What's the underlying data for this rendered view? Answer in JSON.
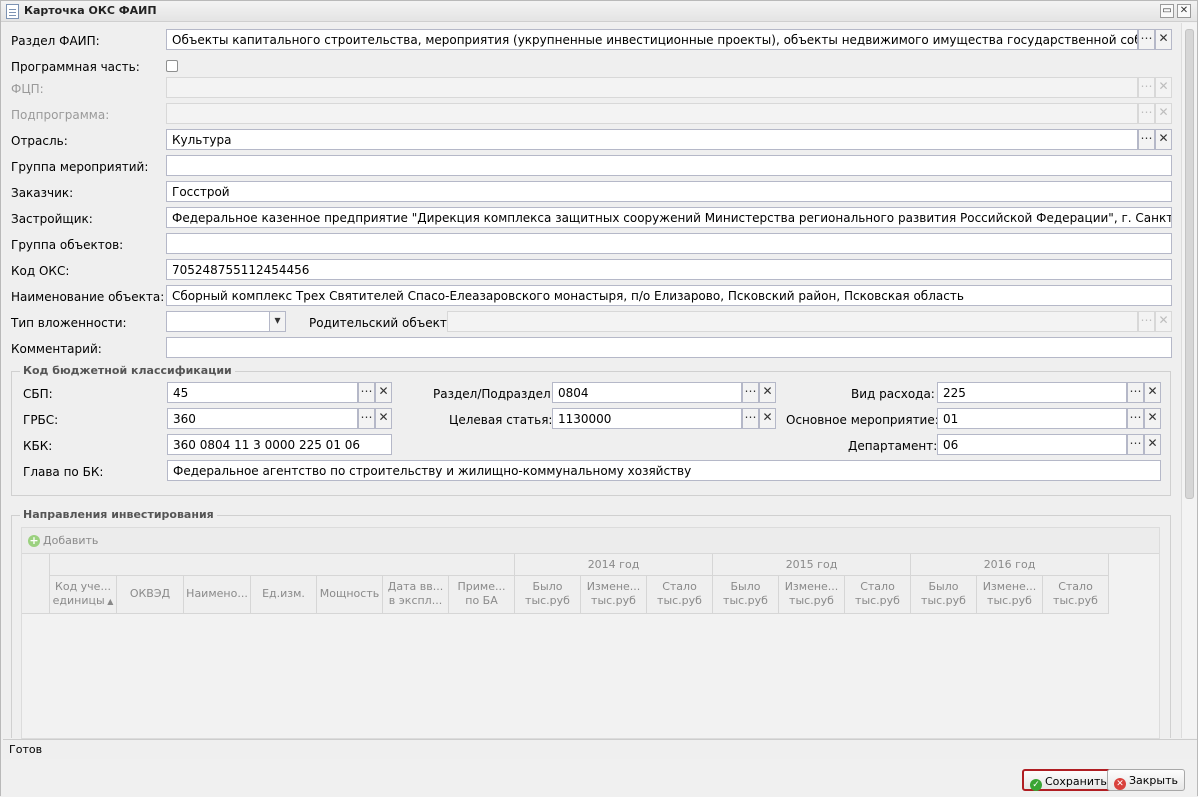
{
  "window": {
    "title": "Карточка ОКС ФАИП",
    "restore_glyph": "▭",
    "close_glyph": "✕"
  },
  "buttons": {
    "lookup": "⋯",
    "clear": "✕",
    "dropdown": "▾"
  },
  "labels": {
    "razdel": "Раздел ФАИП:",
    "programmnaya": "Программная часть:",
    "fcp": "ФЦП:",
    "podprogramma": "Подпрограмма:",
    "otrasl": "Отрасль:",
    "gruppa_meropriyatiy": "Группа мероприятий:",
    "zakazchik": "Заказчик:",
    "zastroyshik": "Застройщик:",
    "gruppa_obektov": "Группа объектов:",
    "kod_oks": "Код ОКС:",
    "naimenovanie": "Наименование объекта:",
    "tip_vlozhennosti": "Тип вложенности:",
    "roditelsky": "Родительский объект:",
    "kommentariy": "Комментарий:"
  },
  "values": {
    "razdel": "Объекты капитального строительства, мероприятия (укрупненные инвестиционные проекты), объекты недвижимого имущества государственной собственности Российской Федерации",
    "programmnaya_checked": false,
    "fcp": "",
    "podprogramma": "",
    "otrasl": "Культура",
    "gruppa_meropriyatiy": "",
    "zakazchik": "Госстрой",
    "zastroyshik": "Федеральное казенное предприятие \"Дирекция комплекса защитных сооружений Министерства регионального развития Российской Федерации\", г. Санкт-Петербург",
    "gruppa_obektov": "",
    "kod_oks": "705248755112454456",
    "naimenovanie": "Сборный комплекс Трех Святителей Спасо-Елеазаровского монастыря, п/о Елизарово, Псковский район, Псковская область",
    "tip_vlozhennosti": "",
    "roditelsky": "",
    "kommentariy": ""
  },
  "kbk_section": {
    "legend": "Код бюджетной классификации",
    "labels": {
      "sbp": "СБП:",
      "grbs": "ГРБС:",
      "kbk": "КБК:",
      "glava": "Глава по БК:",
      "razdel_podrazdel": "Раздел/Подраздел:",
      "celevaya": "Целевая статья:",
      "vid_rashoda": "Вид расхода:",
      "osnovnoe": "Основное мероприятие:",
      "departament": "Департамент:"
    },
    "values": {
      "sbp": "45",
      "grbs": "360",
      "kbk": "360 0804 11 3 0000 225 01 06",
      "glava": "Федеральное агентство по строительству и жилищно-коммунальному хозяйству",
      "razdel_podrazdel": "0804",
      "celevaya": "1130000",
      "vid_rashoda": "225",
      "osnovnoe": "01",
      "departament": "06"
    }
  },
  "invest_section": {
    "legend": "Направления инвестирования",
    "add_button": "Добавить",
    "years": [
      "2014 год",
      "2015 год",
      "2016 год"
    ],
    "columns": [
      "Код уче... единицы",
      "ОКВЭД",
      "Наимено...",
      "Ед.изм.",
      "Мощность",
      "Дата вв... в экспл...",
      "Приме... по БА"
    ],
    "sort_glyph": "▲",
    "year_columns": [
      "Было тыс.руб",
      "Измене... тыс.руб",
      "Стало тыс.руб"
    ],
    "rows": []
  },
  "status": "Готов",
  "footer": {
    "save": "Сохранить",
    "close": "Закрыть",
    "save_glyph": "✓",
    "close_glyph": "✕"
  },
  "colors": {
    "accent_border": "#b01e23",
    "save_icon": "#3aa534",
    "close_icon": "#d9413c"
  }
}
